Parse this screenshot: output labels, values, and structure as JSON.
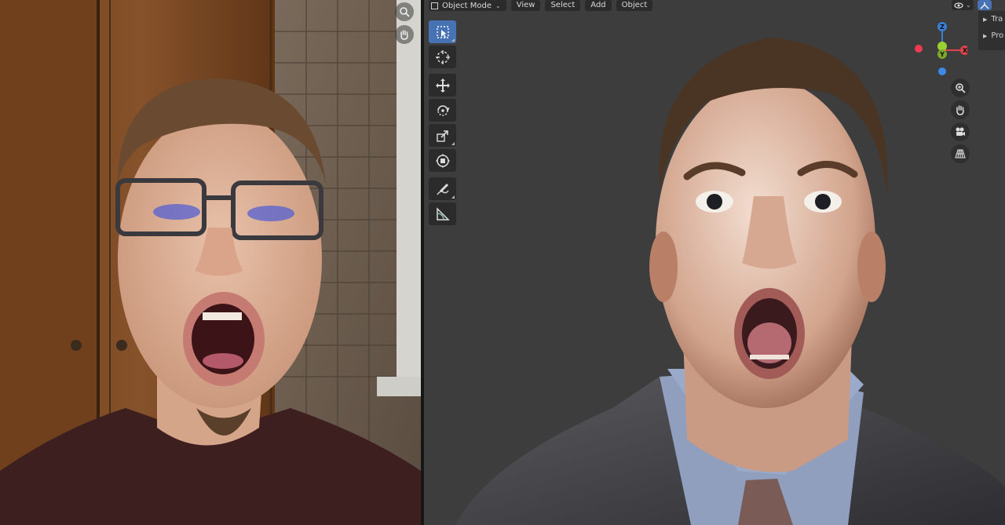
{
  "viewport": {
    "header": {
      "mode": "Object Mode",
      "menus": [
        "View",
        "Select",
        "Add",
        "Object"
      ]
    },
    "toolbar": {
      "tools": [
        "select-box",
        "cursor",
        "move",
        "rotate",
        "scale",
        "transform",
        "annotate",
        "measure"
      ],
      "active_tool": "select-box"
    },
    "gizmo": {
      "axes": [
        "Z",
        "Y",
        "X"
      ]
    },
    "nav_buttons": [
      "zoom-icon",
      "hand-pan-icon",
      "camera-icon",
      "grid-perspective-icon"
    ],
    "side_panel": {
      "items": [
        "Tra",
        "Pro"
      ]
    }
  },
  "webcam": {
    "tools": [
      "zoom-icon",
      "hand-pan-icon"
    ]
  },
  "colors": {
    "viewport_bg": "#3d3d3d",
    "active_tool": "#4772b3",
    "axis_x": "#e0444f",
    "axis_y": "#7ba82a",
    "axis_z": "#3a7fd6"
  }
}
